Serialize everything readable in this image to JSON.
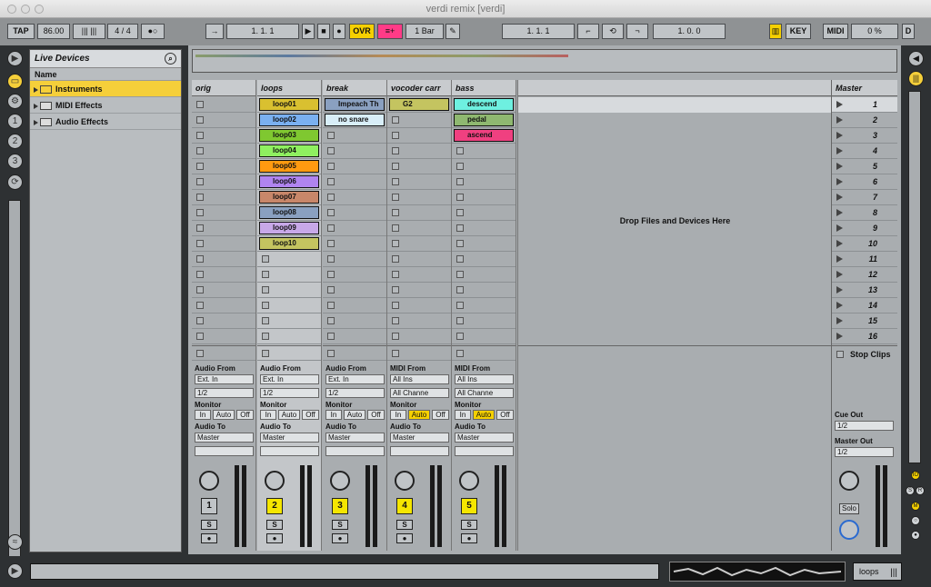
{
  "window": {
    "title": "verdi remix  [verdi]"
  },
  "control_bar": {
    "tap": "TAP",
    "tempo": "86.00",
    "meter": "4 / 4",
    "position": "1.   1.   1",
    "ovr": "OVR",
    "quantize": "1 Bar",
    "loop_start": "1.   1.   1",
    "loop_length": "1.   0.   0",
    "key": "KEY",
    "midi": "MIDI",
    "cpu": "0 %",
    "d": "D"
  },
  "browser": {
    "title": "Live Devices",
    "column_header": "Name",
    "items": [
      {
        "label": "Instruments"
      },
      {
        "label": "MIDI Effects"
      },
      {
        "label": "Audio Effects"
      }
    ]
  },
  "tracks": [
    {
      "name": "orig",
      "number": "1",
      "io_type": "Audio From",
      "input": "Ext. In",
      "channel": "1/2",
      "audio_to": "Master",
      "monitor": [
        "In",
        "Auto",
        "Off"
      ],
      "clips": []
    },
    {
      "name": "loops",
      "number": "2",
      "io_type": "Audio From",
      "input": "Ext. In",
      "channel": "1/2",
      "audio_to": "Master",
      "monitor": [
        "In",
        "Auto",
        "Off"
      ],
      "clips": [
        {
          "slot": 0,
          "label": "loop01",
          "color": "#d9c030"
        },
        {
          "slot": 1,
          "label": "loop02",
          "color": "#7ab0f0"
        },
        {
          "slot": 2,
          "label": "loop03",
          "color": "#7fc830"
        },
        {
          "slot": 3,
          "label": "loop04",
          "color": "#8ff060"
        },
        {
          "slot": 4,
          "label": "loop05",
          "color": "#ff9a10"
        },
        {
          "slot": 5,
          "label": "loop06",
          "color": "#b084f0"
        },
        {
          "slot": 6,
          "label": "loop07",
          "color": "#c8876a"
        },
        {
          "slot": 7,
          "label": "loop08",
          "color": "#8aa0c0"
        },
        {
          "slot": 8,
          "label": "loop09",
          "color": "#c8a8e8"
        },
        {
          "slot": 9,
          "label": "loop10",
          "color": "#c4c460"
        }
      ]
    },
    {
      "name": "break",
      "number": "3",
      "io_type": "Audio From",
      "input": "Ext. In",
      "channel": "1/2",
      "audio_to": "Master",
      "monitor": [
        "In",
        "Auto",
        "Off"
      ],
      "clips": [
        {
          "slot": 0,
          "label": "Impeach Th",
          "color": "#8aa0c0"
        },
        {
          "slot": 1,
          "label": "no snare",
          "color": "#d8eef8"
        }
      ]
    },
    {
      "name": "vocoder carr",
      "number": "4",
      "io_type": "MIDI From",
      "input": "All Ins",
      "channel": "All Channe",
      "audio_to": "Master",
      "monitor": [
        "In",
        "Auto",
        "Off"
      ],
      "clips": [
        {
          "slot": 0,
          "label": "G2",
          "color": "#c4c460"
        }
      ]
    },
    {
      "name": "bass",
      "number": "5",
      "io_type": "MIDI From",
      "input": "All Ins",
      "channel": "All Channe",
      "audio_to": "Master",
      "monitor": [
        "In",
        "Auto",
        "Off"
      ],
      "clips": [
        {
          "slot": 0,
          "label": "descend",
          "color": "#6ef0e0"
        },
        {
          "slot": 1,
          "label": "pedal",
          "color": "#8fb870"
        },
        {
          "slot": 2,
          "label": "ascend",
          "color": "#f04080"
        }
      ]
    }
  ],
  "drop_area": {
    "text": "Drop Files and Devices Here"
  },
  "master": {
    "name": "Master",
    "scenes": [
      "1",
      "2",
      "3",
      "4",
      "5",
      "6",
      "7",
      "8",
      "9",
      "10",
      "11",
      "12",
      "13",
      "14",
      "15",
      "16"
    ],
    "stop_clips": "Stop Clips",
    "cue_out_label": "Cue Out",
    "cue_out": "1/2",
    "master_out_label": "Master Out",
    "master_out": "1/2",
    "solo": "Solo"
  },
  "status": {
    "loops": "loops"
  }
}
